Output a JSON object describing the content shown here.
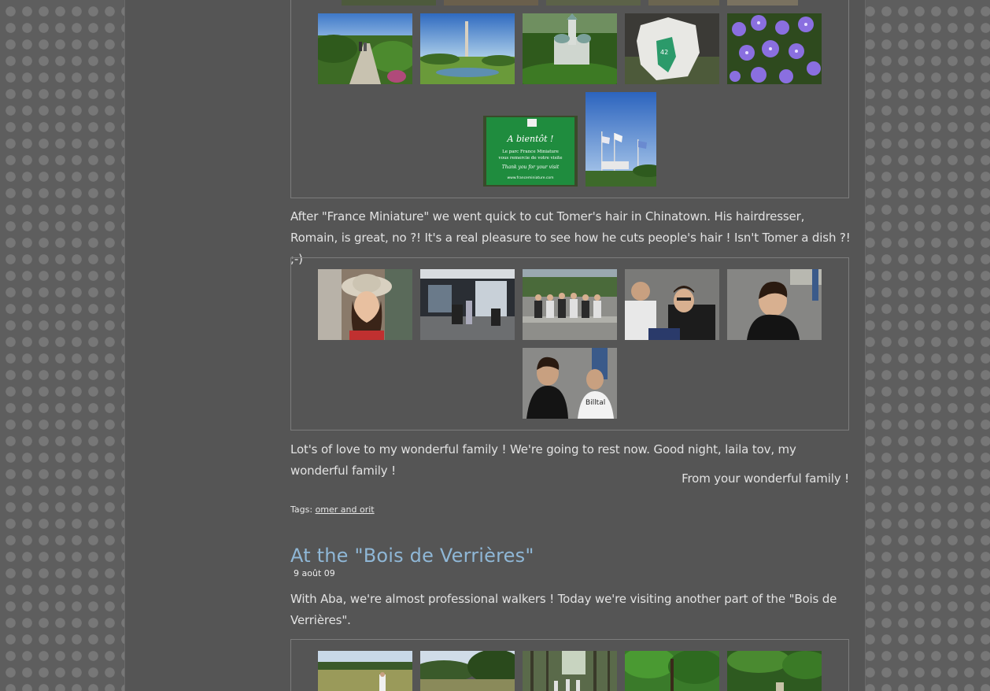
{
  "paragraphs": {
    "chinatown": "After \"France Miniature\" we went quick to cut Tomer's hair in Chinatown. His hairdresser, Romain, is great, no ?! It's a real pleasure to see how he cuts people's hair ! Isn't Tomer a dish ?! ;-)",
    "love": "Lot's of love to my wonderful family ! We're going to rest now. Good night, laila tov, my wonderful family !",
    "signature": "From your wonderful family !"
  },
  "tags": {
    "label": "Tags:",
    "link": "omer and orit"
  },
  "post": {
    "title": "At the \"Bois de Verrières\"",
    "date": "9 août 09",
    "intro": "With Aba, we're almost professional walkers ! Today we're visiting another part of the \"Bois de Verrières\"."
  },
  "photos": {
    "sign_top": "A bientôt !",
    "sign_line1": "Le parc France Miniature",
    "sign_line2": "vous remercie de votre visite",
    "sign_line3": "Thank you for your visit",
    "sign_url": "www.franceminiature.com",
    "map_number": "42"
  },
  "colors": {
    "page_bg": "#555555",
    "title": "#8fb7d6",
    "text": "#e2e2e2"
  }
}
